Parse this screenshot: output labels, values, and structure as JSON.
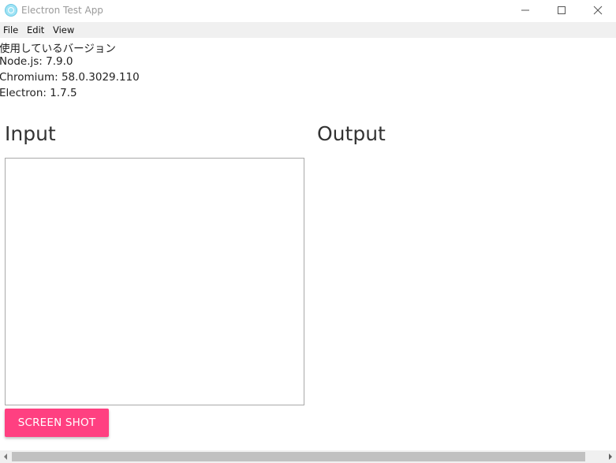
{
  "window": {
    "title": "Electron Test App",
    "icon": "electron-app-icon"
  },
  "menu": {
    "file": "File",
    "edit": "Edit",
    "view": "View"
  },
  "info": {
    "heading": "使用しているバージョン",
    "node": "Node.js: 7.9.0",
    "chromium": "Chromium: 58.0.3029.110",
    "electron": "Electron: 1.7.5"
  },
  "sections": {
    "input_title": "Input",
    "output_title": "Output",
    "input_value": ""
  },
  "button": {
    "screenshot_label": "SCREEN SHOT"
  },
  "colors": {
    "accent": "#ff4081",
    "menubar": "#f0f0f0",
    "scrollbar_thumb": "#c1c1c1"
  }
}
